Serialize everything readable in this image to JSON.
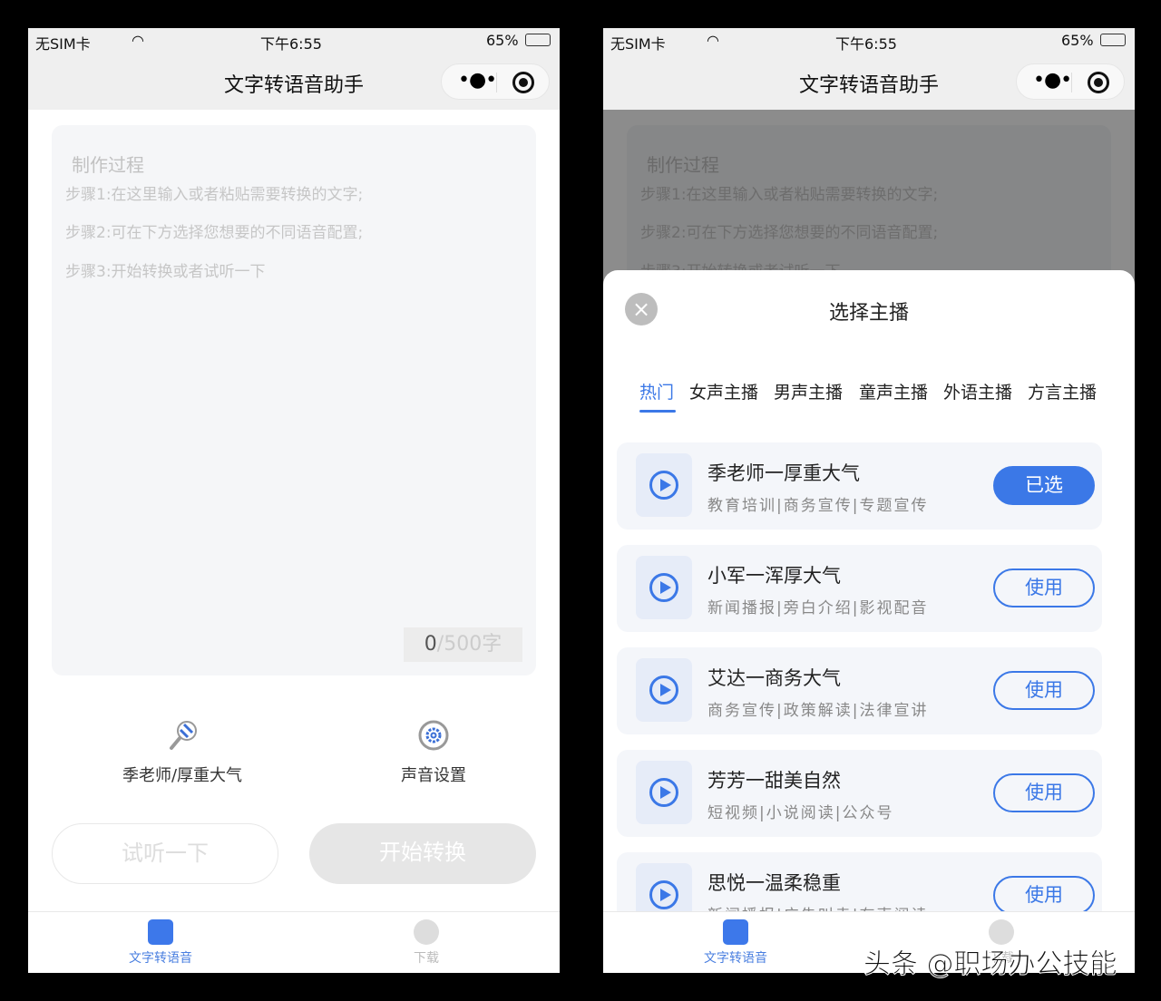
{
  "status": {
    "carrier": "无SIM卡",
    "time": "下午6:55",
    "battery": "65%"
  },
  "nav": {
    "title": "文字转语音助手",
    "more": "•●•"
  },
  "editor": {
    "heading": "制作过程",
    "steps": [
      "步骤1:在这里输入或者粘贴需要转换的文字;",
      "步骤2:可在下方选择您想要的不同语音配置;",
      "步骤3:开始转换或者试听一下"
    ],
    "count": "0",
    "limit": "/500字"
  },
  "options": {
    "voice": "季老师/厚重大气",
    "settings": "声音设置"
  },
  "actions": {
    "listen": "试听一下",
    "start": "开始转换"
  },
  "tabbar": {
    "tts": "文字转语音",
    "download": "下载",
    "active_color": "#4a7fe0"
  },
  "sheet": {
    "title": "选择主播",
    "close": "×",
    "tabs": [
      "热门",
      "女声主播",
      "男声主播",
      "童声主播",
      "外语主播",
      "方言主播"
    ],
    "accent": "#3b78e7",
    "voices": [
      {
        "name": "季老师一厚重大气",
        "tags": "教育培训|商务宣传|专题宣传",
        "button": "已选",
        "selected": true
      },
      {
        "name": "小军一浑厚大气",
        "tags": "新闻播报|旁白介绍|影视配音",
        "button": "使用"
      },
      {
        "name": "艾达一商务大气",
        "tags": "商务宣传|政策解读|法律宣讲",
        "button": "使用"
      },
      {
        "name": "芳芳一甜美自然",
        "tags": "短视频|小说阅读|公众号",
        "button": "使用"
      },
      {
        "name": "思悦一温柔稳重",
        "tags": "新闻播报|广告叫卖|有声阅读",
        "button": "使用"
      }
    ]
  },
  "watermark": "头条 @职场办公技能"
}
